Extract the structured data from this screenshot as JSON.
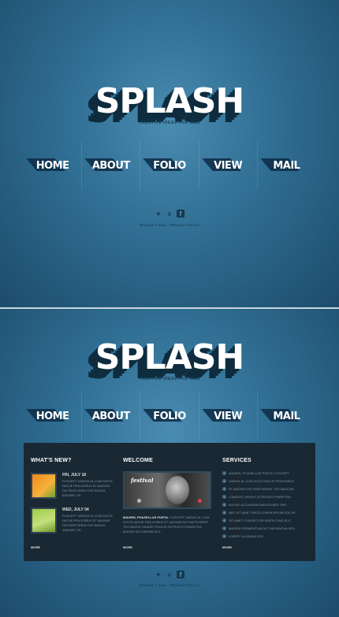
{
  "colors": {
    "background": "#2e6b8f",
    "content_panel": "#1a2833",
    "text_white": "#ffffff"
  },
  "logo": {
    "text": "SPLASH",
    "tagline": "CREATIVE IDEAS FOR WEB"
  },
  "nav": {
    "items": [
      {
        "label": "HOME"
      },
      {
        "label": "ABOUT"
      },
      {
        "label": "FOLIO"
      },
      {
        "label": "VIEW"
      },
      {
        "label": "MAIL"
      }
    ]
  },
  "social": {
    "icons": [
      "twitter-icon",
      "vimeo-icon",
      "facebook-icon"
    ]
  },
  "footer": {
    "copyright": "SPLASH © 2012 · PRIVACY POLICY"
  },
  "whats_new": {
    "title": "WHAT'S NEW?",
    "items": [
      {
        "date": "FRI, JULY 18",
        "text": "FUSCEPT VARIUS AL CUM SOCIS NATUE PEN ATIBUS ET MAGNIS DIS PARTURIEN TES NASUR IDIDARE OR."
      },
      {
        "date": "WED, JULY 04",
        "text": "FUSCEPT VARIUS AL CUM SOCIS NATUE PEN ATIBUS ET MAGNIS DIS PARTURIEN TES NASUR IDIDARE OR."
      }
    ],
    "more": "MORE"
  },
  "welcome": {
    "title": "WELCOME",
    "image_caption": "festival",
    "lead": "MAURIS, PHASELLUS PORTA.",
    "text": "FUSCEPT VARIUS AL CUM SOCIS NATUE PEN ATIBUS ET MAGNIS DIS PARTURIENT TES NASCE DIDARE PROCIS GETROTIS PHARETRA MAGNE ACCUMSAN ALS...",
    "more": "MORE"
  },
  "services": {
    "title": "SERVICES",
    "items": [
      "MAURIS, PHASELLUS PORTA. FUSCEPT",
      "VARIUS AL CUM SOCIS NATUE PEN ATIBUS",
      "ET MAGNIS DIS PARTURIENT TES NASCUR",
      "LOBORTE URGES ULTRICIES PHARETRA",
      "AUGUE ACCUMSAN MALESUADE ORC",
      "NEC SIT AMET EROS LOREM IPSUM DOLOR",
      "SIT AMET CONSECTUR ADIPIS CING ELIT",
      "MAURIS FERMENTUM DICTUM MAGNA SED",
      "LOREET ALIQUAM LEO"
    ],
    "more": "MORE"
  }
}
